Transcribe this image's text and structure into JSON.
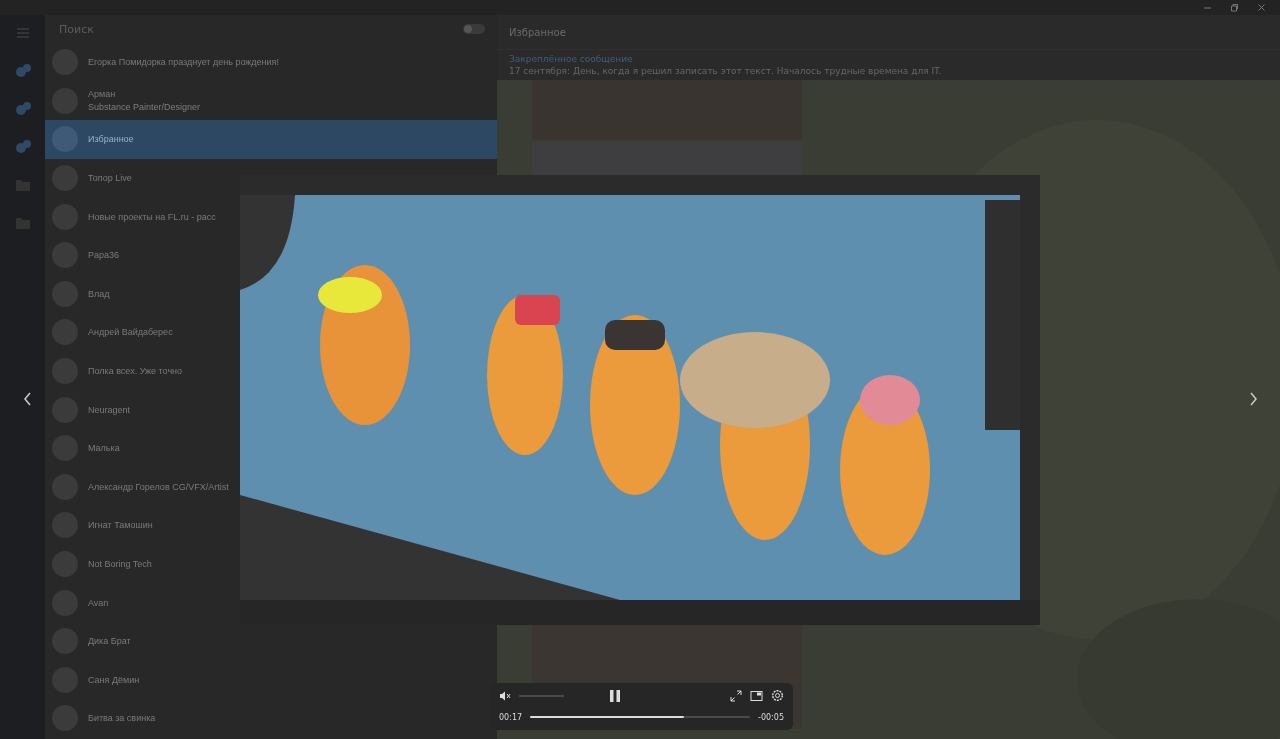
{
  "search": {
    "placeholder": "Поиск",
    "toggle_on": false
  },
  "chats": [
    {
      "name": "Егорка Помидорка празднует день рождения!",
      "selected": false
    },
    {
      "name": "Арман",
      "preview": "Substance Painter/Designer",
      "selected": false
    },
    {
      "name": "Избранное",
      "selected": true
    },
    {
      "name": "Топор Live",
      "selected": false
    },
    {
      "name": "Новые проекты на FL.ru - расс",
      "selected": false
    },
    {
      "name": "Papa36",
      "selected": false
    },
    {
      "name": "Влад",
      "selected": false
    },
    {
      "name": "Андрей Вайдаберес",
      "selected": false
    },
    {
      "name": "Полка всех. Уже точно",
      "selected": false
    },
    {
      "name": "Neuragent",
      "selected": false
    },
    {
      "name": "Малька",
      "selected": false
    },
    {
      "name": "Александр Горелов CG/VFX/Artist",
      "selected": false
    },
    {
      "name": "Игнат Тамошин",
      "selected": false
    },
    {
      "name": "Not Boring Tech",
      "selected": false
    },
    {
      "name": "Avan",
      "selected": false
    },
    {
      "name": "Дика Брат",
      "selected": false
    },
    {
      "name": "Саня Дёмин",
      "selected": false
    },
    {
      "name": "Битва за свинка",
      "selected": false
    }
  ],
  "chat": {
    "title": "Избранное",
    "pinned_label": "Закреплённое сообщение",
    "pinned_text": "17 сентября: День, когда я решил записать этот текст. Началось трудные времена для IT."
  },
  "player": {
    "muted": true,
    "volume": {
      "level": 0
    },
    "playing": true,
    "position": "00:17",
    "remaining": "-00:05",
    "progress": {
      "level": 0.7
    }
  }
}
